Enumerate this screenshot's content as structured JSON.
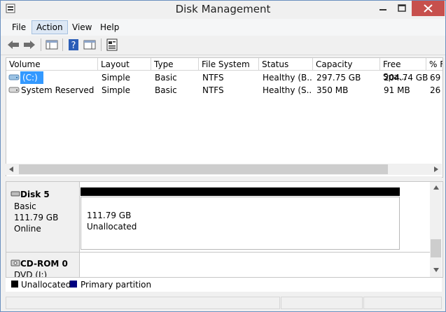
{
  "window": {
    "title": "Disk Management"
  },
  "menu": [
    "File",
    "Action",
    "View",
    "Help"
  ],
  "columns": [
    "Volume",
    "Layout",
    "Type",
    "File System",
    "Status",
    "Capacity",
    "Free Spa...",
    "% F"
  ],
  "volumes": [
    {
      "volume": "(C:)",
      "layout": "Simple",
      "type": "Basic",
      "fs": "NTFS",
      "status": "Healthy (B...",
      "capacity": "297.75 GB",
      "free": "204.74 GB",
      "pct": "69"
    },
    {
      "volume": "System Reserved",
      "layout": "Simple",
      "type": "Basic",
      "fs": "NTFS",
      "status": "Healthy (S...",
      "capacity": "350 MB",
      "free": "91 MB",
      "pct": "26"
    }
  ],
  "disks": [
    {
      "name": "Disk 5",
      "kind": "Basic",
      "size": "111.79 GB",
      "state": "Online",
      "partition": {
        "size": "111.79 GB",
        "label": "Unallocated"
      }
    },
    {
      "name": "CD-ROM 0",
      "kind": "DVD (I:)"
    }
  ],
  "legend": [
    {
      "label": "Unallocated",
      "color": "#000000"
    },
    {
      "label": "Primary partition",
      "color": "#000080"
    }
  ],
  "colors": {
    "accent": "#3399ff",
    "close": "#c7504d"
  }
}
